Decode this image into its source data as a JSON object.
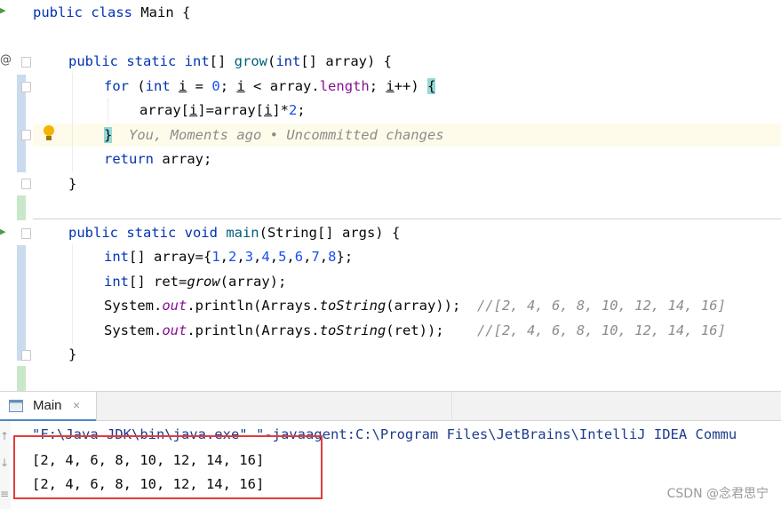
{
  "editor": {
    "lines": [
      {
        "id": "l1",
        "segments": [
          [
            "kw",
            "public class "
          ],
          [
            "",
            "Main {"
          ]
        ]
      },
      {
        "id": "l2",
        "segments": [
          [
            "kw",
            "public static "
          ],
          [
            "kw",
            "int"
          ],
          [
            "",
            "[] "
          ],
          [
            "fn",
            "grow"
          ],
          [
            "",
            "("
          ],
          [
            "kw",
            "int"
          ],
          [
            "",
            "[] array) {"
          ]
        ]
      },
      {
        "id": "l3",
        "segments": [
          [
            "kw",
            "for "
          ],
          [
            "",
            "("
          ],
          [
            "kw",
            "int "
          ],
          [
            "ul",
            "i"
          ],
          [
            "",
            " = "
          ],
          [
            "num",
            "0"
          ],
          [
            "",
            "; "
          ],
          [
            "ul",
            "i"
          ],
          [
            "",
            " < array."
          ],
          [
            "fld",
            "length"
          ],
          [
            "",
            "; "
          ],
          [
            "ul",
            "i"
          ],
          [
            "",
            "++) "
          ],
          [
            "bh",
            "{"
          ]
        ]
      },
      {
        "id": "l4",
        "segments": [
          [
            "",
            "array["
          ],
          [
            "ul",
            "i"
          ],
          [
            "",
            "]=array["
          ],
          [
            "ul",
            "i"
          ],
          [
            "",
            "]*"
          ],
          [
            "num",
            "2"
          ],
          [
            "",
            ";"
          ]
        ]
      },
      {
        "id": "l5",
        "segments": [
          [
            "bh",
            "}"
          ],
          [
            "",
            "  "
          ],
          [
            "cm",
            "You, Moments ago • Uncommitted changes"
          ]
        ]
      },
      {
        "id": "l6",
        "segments": [
          [
            "kw",
            "return "
          ],
          [
            "",
            "array;"
          ]
        ]
      },
      {
        "id": "l7",
        "segments": [
          [
            "",
            "}"
          ]
        ]
      },
      {
        "id": "l8",
        "segments": [
          [
            "kw",
            "public static void "
          ],
          [
            "fn",
            "main"
          ],
          [
            "",
            "(String[] args) {"
          ]
        ]
      },
      {
        "id": "l9",
        "segments": [
          [
            "kw",
            "int"
          ],
          [
            "",
            "[] array={"
          ],
          [
            "num",
            "1"
          ],
          [
            "",
            ","
          ],
          [
            "num",
            "2"
          ],
          [
            "",
            ","
          ],
          [
            "num",
            "3"
          ],
          [
            "",
            ","
          ],
          [
            "num",
            "4"
          ],
          [
            "",
            ","
          ],
          [
            "num",
            "5"
          ],
          [
            "",
            ","
          ],
          [
            "num",
            "6"
          ],
          [
            "",
            ","
          ],
          [
            "num",
            "7"
          ],
          [
            "",
            ","
          ],
          [
            "num",
            "8"
          ],
          [
            "",
            "};"
          ]
        ]
      },
      {
        "id": "l10",
        "segments": [
          [
            "kw",
            "int"
          ],
          [
            "",
            "[] ret="
          ],
          [
            "it",
            "grow"
          ],
          [
            "",
            "(array);"
          ]
        ]
      },
      {
        "id": "l11",
        "segments": [
          [
            "",
            "System."
          ],
          [
            "st",
            "out"
          ],
          [
            "",
            ".println(Arrays."
          ],
          [
            "it",
            "toString"
          ],
          [
            "",
            "(array));  "
          ],
          [
            "cm",
            "//[2, 4, 6, 8, 10, 12, 14, 16]"
          ]
        ]
      },
      {
        "id": "l12",
        "segments": [
          [
            "",
            "System."
          ],
          [
            "st",
            "out"
          ],
          [
            "",
            ".println(Arrays."
          ],
          [
            "it",
            "toString"
          ],
          [
            "",
            "(ret));    "
          ],
          [
            "cm",
            "//[2, 4, 6, 8, 10, 12, 14, 16]"
          ]
        ]
      },
      {
        "id": "l13",
        "segments": [
          [
            "",
            "}"
          ]
        ]
      }
    ]
  },
  "run_panel": {
    "tab_label": "Main",
    "tab_close": "×",
    "command": "\"F:\\Java JDK\\bin\\java.exe\" \"-javaagent:C:\\Program Files\\JetBrains\\IntelliJ IDEA Commu",
    "output": [
      "[2, 4, 6, 8, 10, 12, 14, 16]",
      "[2, 4, 6, 8, 10, 12, 14, 16]"
    ]
  },
  "gutter": {
    "annotation_symbol": "@"
  },
  "watermark": "CSDN @念君思宁"
}
